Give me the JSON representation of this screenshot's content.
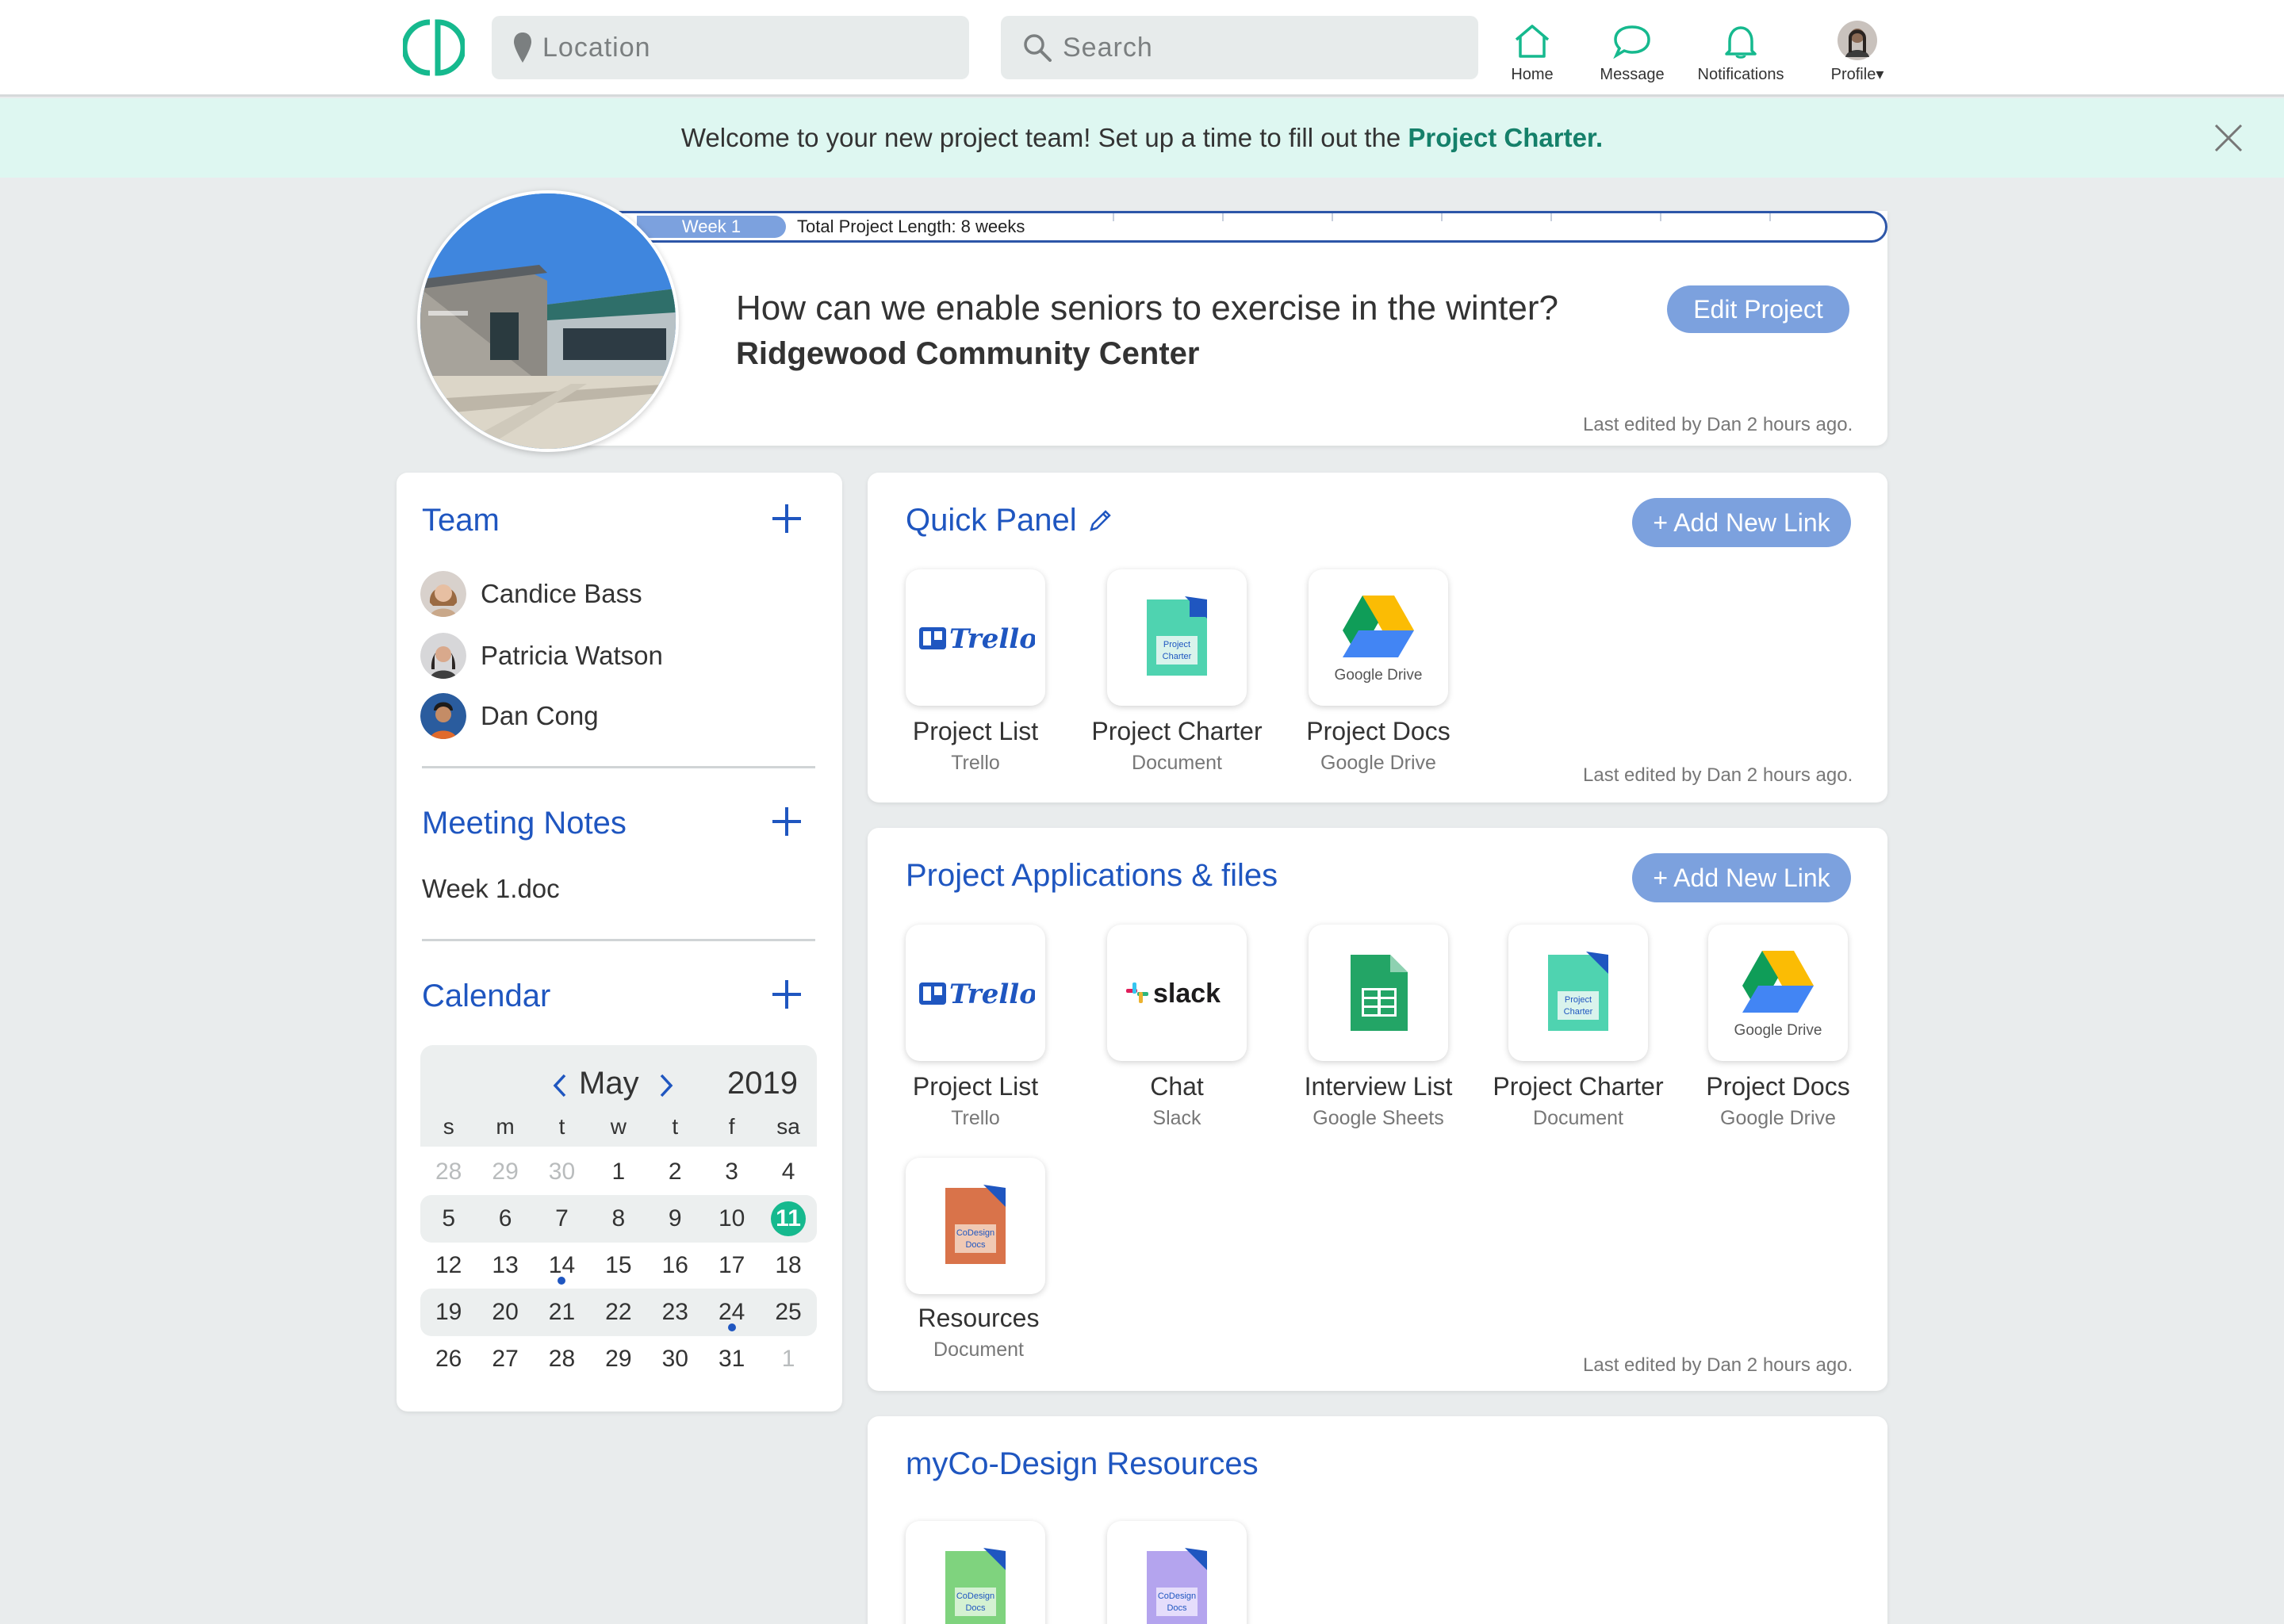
{
  "nav": {
    "location_placeholder": "Location",
    "search_placeholder": "Search",
    "items": [
      {
        "label": "Home",
        "icon": "home-icon"
      },
      {
        "label": "Message",
        "icon": "message-icon"
      },
      {
        "label": "Notifications",
        "icon": "bell-icon"
      },
      {
        "label": "Profile▾",
        "icon": "avatar"
      }
    ]
  },
  "banner": {
    "text": "Welcome to your new project team! Set up a time to fill out the ",
    "link": "Project Charter."
  },
  "project": {
    "week_label": "Week 1",
    "total_length": "Total Project Length: 8 weeks",
    "question": "How can we enable seniors to exercise in the winter?",
    "organization": "Ridgewood Community Center",
    "edit_button": "Edit Project",
    "last_edited": "Last edited by Dan 2 hours ago.",
    "progress_fraction": 0.125
  },
  "team": {
    "title": "Team",
    "members": [
      "Candice Bass",
      "Patricia Watson",
      "Dan Cong"
    ]
  },
  "meeting_notes": {
    "title": "Meeting Notes",
    "items": [
      "Week 1.doc"
    ]
  },
  "calendar": {
    "title": "Calendar",
    "month": "May",
    "year": "2019",
    "weekdays": [
      "s",
      "m",
      "t",
      "w",
      "t",
      "f",
      "sa"
    ],
    "weeks": [
      [
        "28",
        "29",
        "30",
        "1",
        "2",
        "3",
        "4"
      ],
      [
        "5",
        "6",
        "7",
        "8",
        "9",
        "10",
        "11"
      ],
      [
        "12",
        "13",
        "14",
        "15",
        "16",
        "17",
        "18"
      ],
      [
        "19",
        "20",
        "21",
        "22",
        "23",
        "24",
        "25"
      ],
      [
        "26",
        "27",
        "28",
        "29",
        "30",
        "31",
        "1"
      ]
    ],
    "today": "11",
    "event_days": [
      "14",
      "24"
    ]
  },
  "quick_panel": {
    "title": "Quick Panel",
    "add_link": "+ Add New Link",
    "last_edited": "Last edited by Dan 2 hours ago.",
    "tiles": [
      {
        "name": "Project List",
        "sub": "Trello",
        "logo": "Trello"
      },
      {
        "name": "Project Charter",
        "sub": "Document",
        "logo": "Project Charter"
      },
      {
        "name": "Project Docs",
        "sub": "Google Drive",
        "logo": "Google Drive"
      }
    ]
  },
  "applications": {
    "title": "Project Applications & files",
    "add_link": "+ Add New Link",
    "last_edited": "Last edited by Dan 2 hours ago.",
    "tiles": [
      {
        "name": "Project List",
        "sub": "Trello",
        "logo": "Trello"
      },
      {
        "name": "Chat",
        "sub": "Slack",
        "logo": "slack"
      },
      {
        "name": "Interview List",
        "sub": "Google Sheets",
        "logo": ""
      },
      {
        "name": "Project Charter",
        "sub": "Document",
        "logo": "Project Charter"
      },
      {
        "name": "Project Docs",
        "sub": "Google Drive",
        "logo": "Google Drive"
      },
      {
        "name": "Resources",
        "sub": "Document",
        "logo": "CoDesign Docs"
      }
    ]
  },
  "resources": {
    "title": "myCo-Design Resources",
    "tiles": [
      {
        "logo": "CoDesign Docs"
      },
      {
        "logo": "CoDesign Docs"
      }
    ]
  },
  "colors": {
    "accent_green": "#16b98e",
    "link_blue": "#1f56c0",
    "button_blue": "#7ca1de",
    "banner_bg": "#def7f1"
  }
}
